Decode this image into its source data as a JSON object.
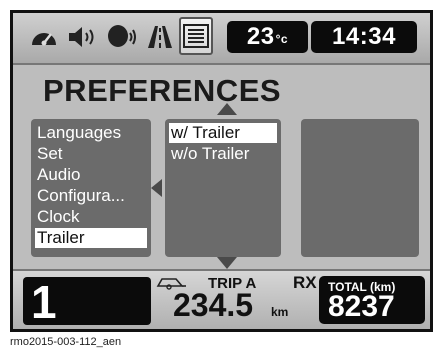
{
  "top_bar": {
    "icons": [
      "speedometer-icon",
      "speaker-icon",
      "rider-headset-icon",
      "road-icon",
      "list-menu-icon"
    ],
    "temperature_value": "23",
    "temperature_unit": "°c",
    "clock": "14:34"
  },
  "screen_title": "PREFERENCES",
  "menu": {
    "items": [
      "Languages",
      "Set",
      "Audio",
      "Configura...",
      "Clock",
      "Trailer"
    ],
    "selected": "Trailer"
  },
  "submenu": {
    "items": [
      "w/ Trailer",
      "w/o Trailer"
    ],
    "selected": "w/ Trailer"
  },
  "bottom_bar": {
    "gear": "1",
    "trip_label": "TRIP A",
    "trip_value": "234.5",
    "trip_unit": "km",
    "rx_label": "RX",
    "total_label": "TOTAL (km)",
    "total_value": "8237"
  },
  "caption": "rmo2015-003-112_aen"
}
